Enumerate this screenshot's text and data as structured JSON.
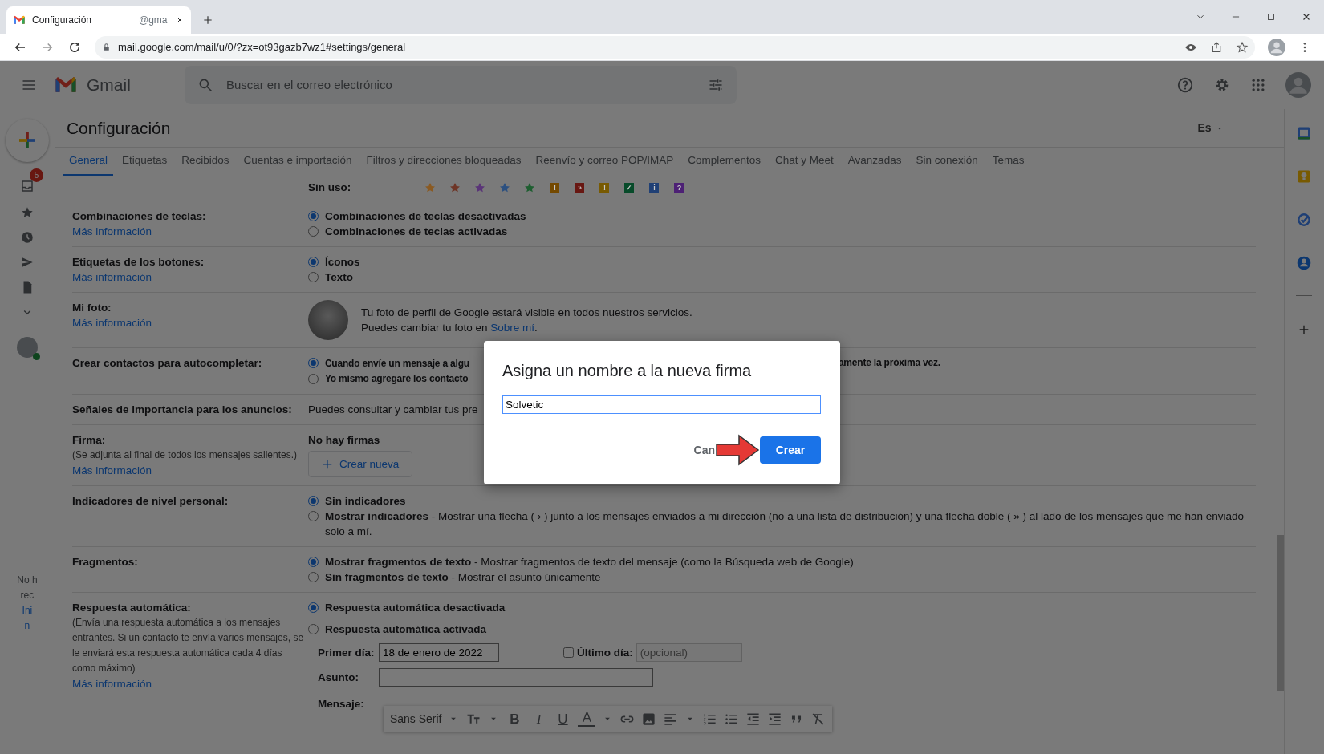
{
  "browser": {
    "tab_title": "Configuración",
    "tab_extra": "@gma",
    "url": "mail.google.com/mail/u/0/?zx=ot93gazb7wz1#settings/general"
  },
  "header": {
    "product": "Gmail",
    "search_placeholder": "Buscar en el correo electrónico"
  },
  "rail": {
    "inbox_badge": "5",
    "notice": [
      {
        "text": "No h",
        "link": false
      },
      {
        "text": "rec",
        "link": false
      },
      {
        "text": "Ini",
        "link": true
      },
      {
        "text": "n",
        "link": true
      }
    ]
  },
  "page": {
    "title": "Configuración",
    "language": "Es"
  },
  "tabs": [
    {
      "label": "General",
      "selected": true
    },
    {
      "label": "Etiquetas",
      "selected": false
    },
    {
      "label": "Recibidos",
      "selected": false
    },
    {
      "label": "Cuentas e importación",
      "selected": false
    },
    {
      "label": "Filtros y direcciones bloqueadas",
      "selected": false
    },
    {
      "label": "Reenvío y correo POP/IMAP",
      "selected": false
    },
    {
      "label": "Complementos",
      "selected": false
    },
    {
      "label": "Chat y Meet",
      "selected": false
    },
    {
      "label": "Avanzadas",
      "selected": false
    },
    {
      "label": "Sin conexión",
      "selected": false
    },
    {
      "label": "Temas",
      "selected": false
    }
  ],
  "settings": [
    {
      "kind": "stars",
      "value_label": "Sin uso:",
      "marks": [
        {
          "kind": "star",
          "color": "#8a5a22"
        },
        {
          "kind": "star",
          "color": "#6e3526"
        },
        {
          "kind": "star",
          "color": "#5a3478"
        },
        {
          "kind": "star",
          "color": "#2c5080"
        },
        {
          "kind": "star",
          "color": "#1e5e30"
        },
        {
          "kind": "badge",
          "color": "#744900",
          "glyph": "!"
        },
        {
          "kind": "badge",
          "color": "#681712",
          "glyph": "»"
        },
        {
          "kind": "badge",
          "color": "#785a02",
          "glyph": "!"
        },
        {
          "kind": "badge",
          "color": "#074b2a",
          "glyph": "✓"
        },
        {
          "kind": "badge",
          "color": "#204075",
          "glyph": "i"
        },
        {
          "kind": "badge",
          "color": "#4d2075",
          "glyph": "?"
        }
      ]
    },
    {
      "kind": "radio",
      "label": "Combinaciones de teclas:",
      "link": "Más información",
      "options": [
        {
          "text": "Combinaciones de teclas desactivadas",
          "selected": true
        },
        {
          "text": "Combinaciones de teclas activadas",
          "selected": false
        }
      ]
    },
    {
      "kind": "radio",
      "label": "Etiquetas de los botones:",
      "link": "Más información",
      "options": [
        {
          "text": "Íconos",
          "selected": true
        },
        {
          "text": "Texto",
          "selected": false
        }
      ]
    },
    {
      "kind": "photo",
      "label": "Mi foto:",
      "link": "Más información",
      "line1": "Tu foto de perfil de Google estará visible en todos nuestros servicios.",
      "line2": "Puedes cambiar tu foto en",
      "line2_link": "Sobre mí",
      "line2_end": "."
    },
    {
      "kind": "radio",
      "label": "Crear contactos para autocompletar:",
      "options": [
        {
          "text": "Cuando envíe un mensaje a algu",
          "text_after": "amente la próxima vez.",
          "selected": true
        },
        {
          "text": "Yo mismo agregaré los contacto",
          "selected": false
        }
      ]
    },
    {
      "kind": "text",
      "label": "Señales de importancia para los anuncios:",
      "value": "Puedes consultar y cambiar tus pre"
    },
    {
      "kind": "signature",
      "label": "Firma:",
      "note": "(Se adjunta al final de todos los mensajes salientes.)",
      "link": "Más información",
      "value": "No hay firmas",
      "button": "Crear nueva"
    },
    {
      "kind": "radio",
      "label": "Indicadores de nivel personal:",
      "options": [
        {
          "text": "Sin indicadores",
          "selected": true
        },
        {
          "text": "Mostrar indicadores",
          "desc": " - Mostrar una flecha ( › ) junto a los mensajes enviados a mi dirección (no a una lista de distribución) y una flecha doble ( » ) al lado de los mensajes que me han enviado solo a mí.",
          "selected": false
        }
      ]
    },
    {
      "kind": "radio",
      "label": "Fragmentos:",
      "options": [
        {
          "text": "Mostrar fragmentos de texto",
          "desc": " - Mostrar fragmentos de texto del mensaje (como la Búsqueda web de Google)",
          "selected": true
        },
        {
          "text": "Sin fragmentos de texto",
          "desc": " - Mostrar el asunto únicamente",
          "selected": false
        }
      ]
    },
    {
      "kind": "autoreply",
      "label": "Respuesta automática:",
      "note": "(Envía una respuesta automática a los mensajes entrantes. Si un contacto te envía varios mensajes, se le enviará esta respuesta automática cada 4 días como máximo)",
      "link": "Más información",
      "options": [
        {
          "text": "Respuesta automática desactivada",
          "selected": true
        },
        {
          "text": "Respuesta automática activada",
          "selected": false
        }
      ],
      "first_day_label": "Primer día:",
      "first_day_value": "18 de enero de 2022",
      "last_day_label": "Último día:",
      "last_day_checked": false,
      "last_day_placeholder": "(opcional)",
      "subject_label": "Asunto:",
      "message_label": "Mensaje:",
      "toolbar": {
        "font": "Sans Serif",
        "letters": [
          "B",
          "I",
          "U",
          "A"
        ]
      }
    }
  ],
  "dialog": {
    "title": "Asigna un nombre a la nueva firma",
    "value": "Solvetic",
    "cancel": "Can",
    "ok": "Crear"
  }
}
